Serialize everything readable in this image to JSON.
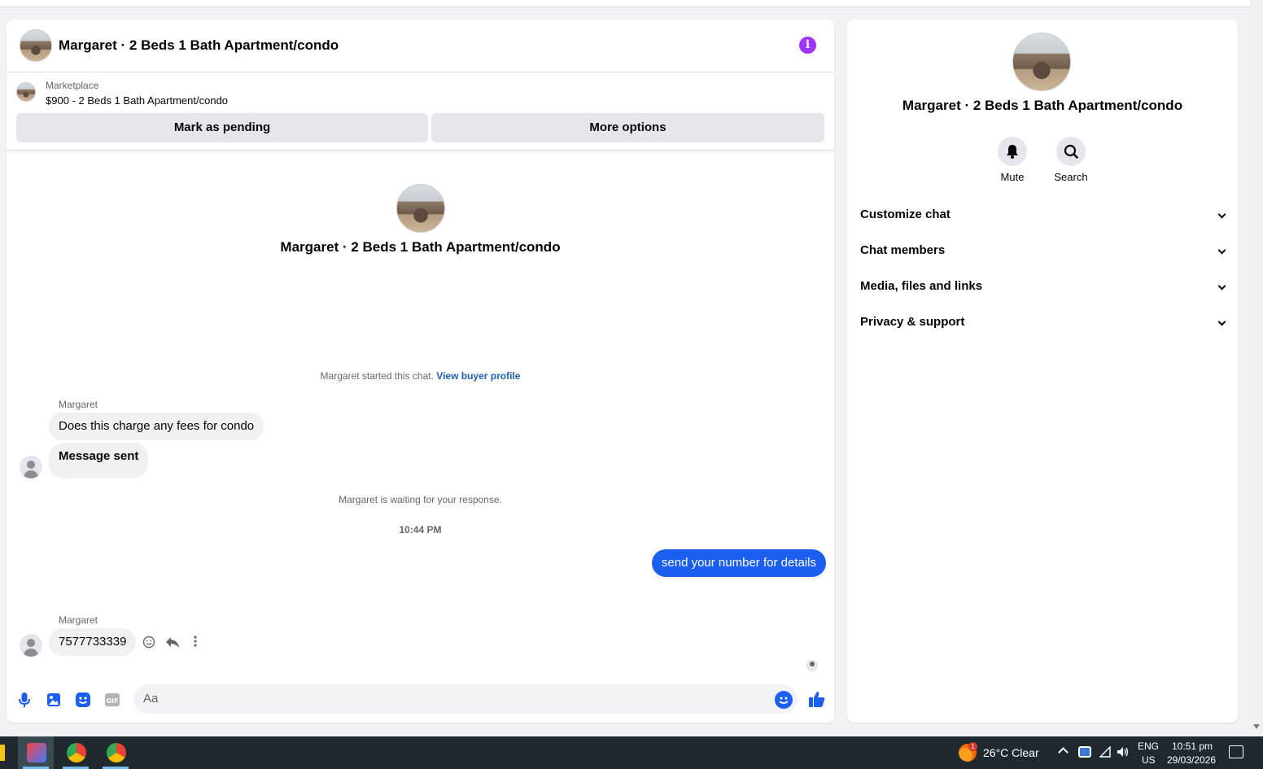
{
  "chat": {
    "title": "Margaret · 2 Beds 1 Bath Apartment/condo",
    "listing": {
      "kicker": "Marketplace",
      "price_title": "$900 - 2 Beds 1 Bath Apartment/condo",
      "mark_pending_label": "Mark as pending",
      "more_options_label": "More options"
    },
    "intro_title": "Margaret · 2 Beds 1 Bath Apartment/condo",
    "started_text": "Margaret started this chat.",
    "view_profile_link": "View buyer profile",
    "messages": [
      {
        "sender": "Margaret",
        "text": "Does this charge any fees for condo"
      },
      {
        "text": "Message sent"
      }
    ],
    "waiting_text": "Margaret is waiting for your response.",
    "timestamp": "10:44 PM",
    "outgoing": "send your number for details",
    "second_sender": "Margaret",
    "second_message": "7577733339",
    "composer_placeholder": "Aa"
  },
  "side": {
    "title": "Margaret · 2 Beds 1 Bath Apartment/condo",
    "actions": [
      {
        "label": "Mute",
        "icon": "bell-icon"
      },
      {
        "label": "Search",
        "icon": "search-icon"
      }
    ],
    "sections": [
      "Customize chat",
      "Chat members",
      "Media, files and links",
      "Privacy & support"
    ]
  },
  "taskbar": {
    "weather": "26°C  Clear",
    "notification_count": "1",
    "language": "ENG",
    "region": "US",
    "time": "10:51 pm",
    "date": "29/03/2026"
  },
  "colors": {
    "accent_blue": "#1c5ff0",
    "info_purple": "#a033ff",
    "link_blue": "#1f5fb4"
  }
}
